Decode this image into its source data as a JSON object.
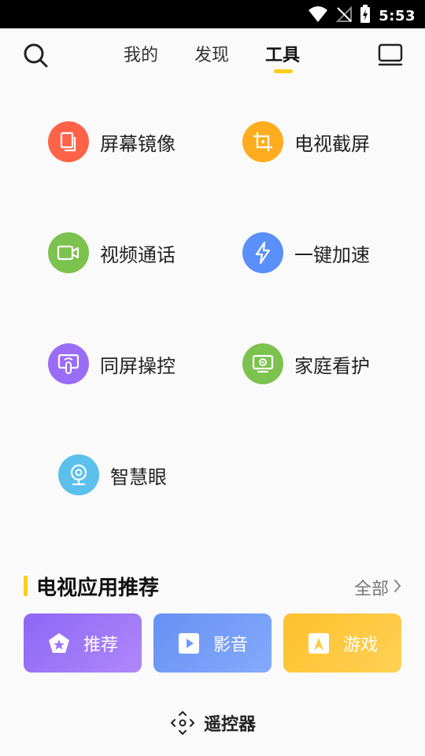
{
  "status_bar": {
    "time": "5:53"
  },
  "nav": {
    "tabs": [
      {
        "label": "我的",
        "active": false
      },
      {
        "label": "发现",
        "active": false
      },
      {
        "label": "工具",
        "active": true
      }
    ]
  },
  "tools": [
    {
      "label": "屏幕镜像",
      "icon": "screen-mirror-icon",
      "color": "#ff6347"
    },
    {
      "label": "电视截屏",
      "icon": "screenshot-crop-icon",
      "color": "#ffad1f"
    },
    {
      "label": "视频通话",
      "icon": "video-camera-icon",
      "color": "#7cc24e"
    },
    {
      "label": "一键加速",
      "icon": "lightning-icon",
      "color": "#5b8ff9"
    },
    {
      "label": "同屏操控",
      "icon": "touch-screen-icon",
      "color": "#9b6cf6"
    },
    {
      "label": "家庭看护",
      "icon": "home-camera-icon",
      "color": "#7cc24e"
    },
    {
      "label": "智慧眼",
      "icon": "webcam-icon",
      "color": "#5bc0eb"
    }
  ],
  "tv_apps": {
    "title": "电视应用推荐",
    "more_label": "全部",
    "cards": [
      {
        "label": "推荐",
        "icon": "pentagon-star-icon",
        "color": "#9f72f7"
      },
      {
        "label": "影音",
        "icon": "play-icon",
        "color": "#6f9bf7"
      },
      {
        "label": "游戏",
        "icon": "game-icon",
        "color": "#ffc93c"
      }
    ]
  },
  "remote": {
    "label": "遥控器",
    "icon": "remote-dpad-icon"
  }
}
